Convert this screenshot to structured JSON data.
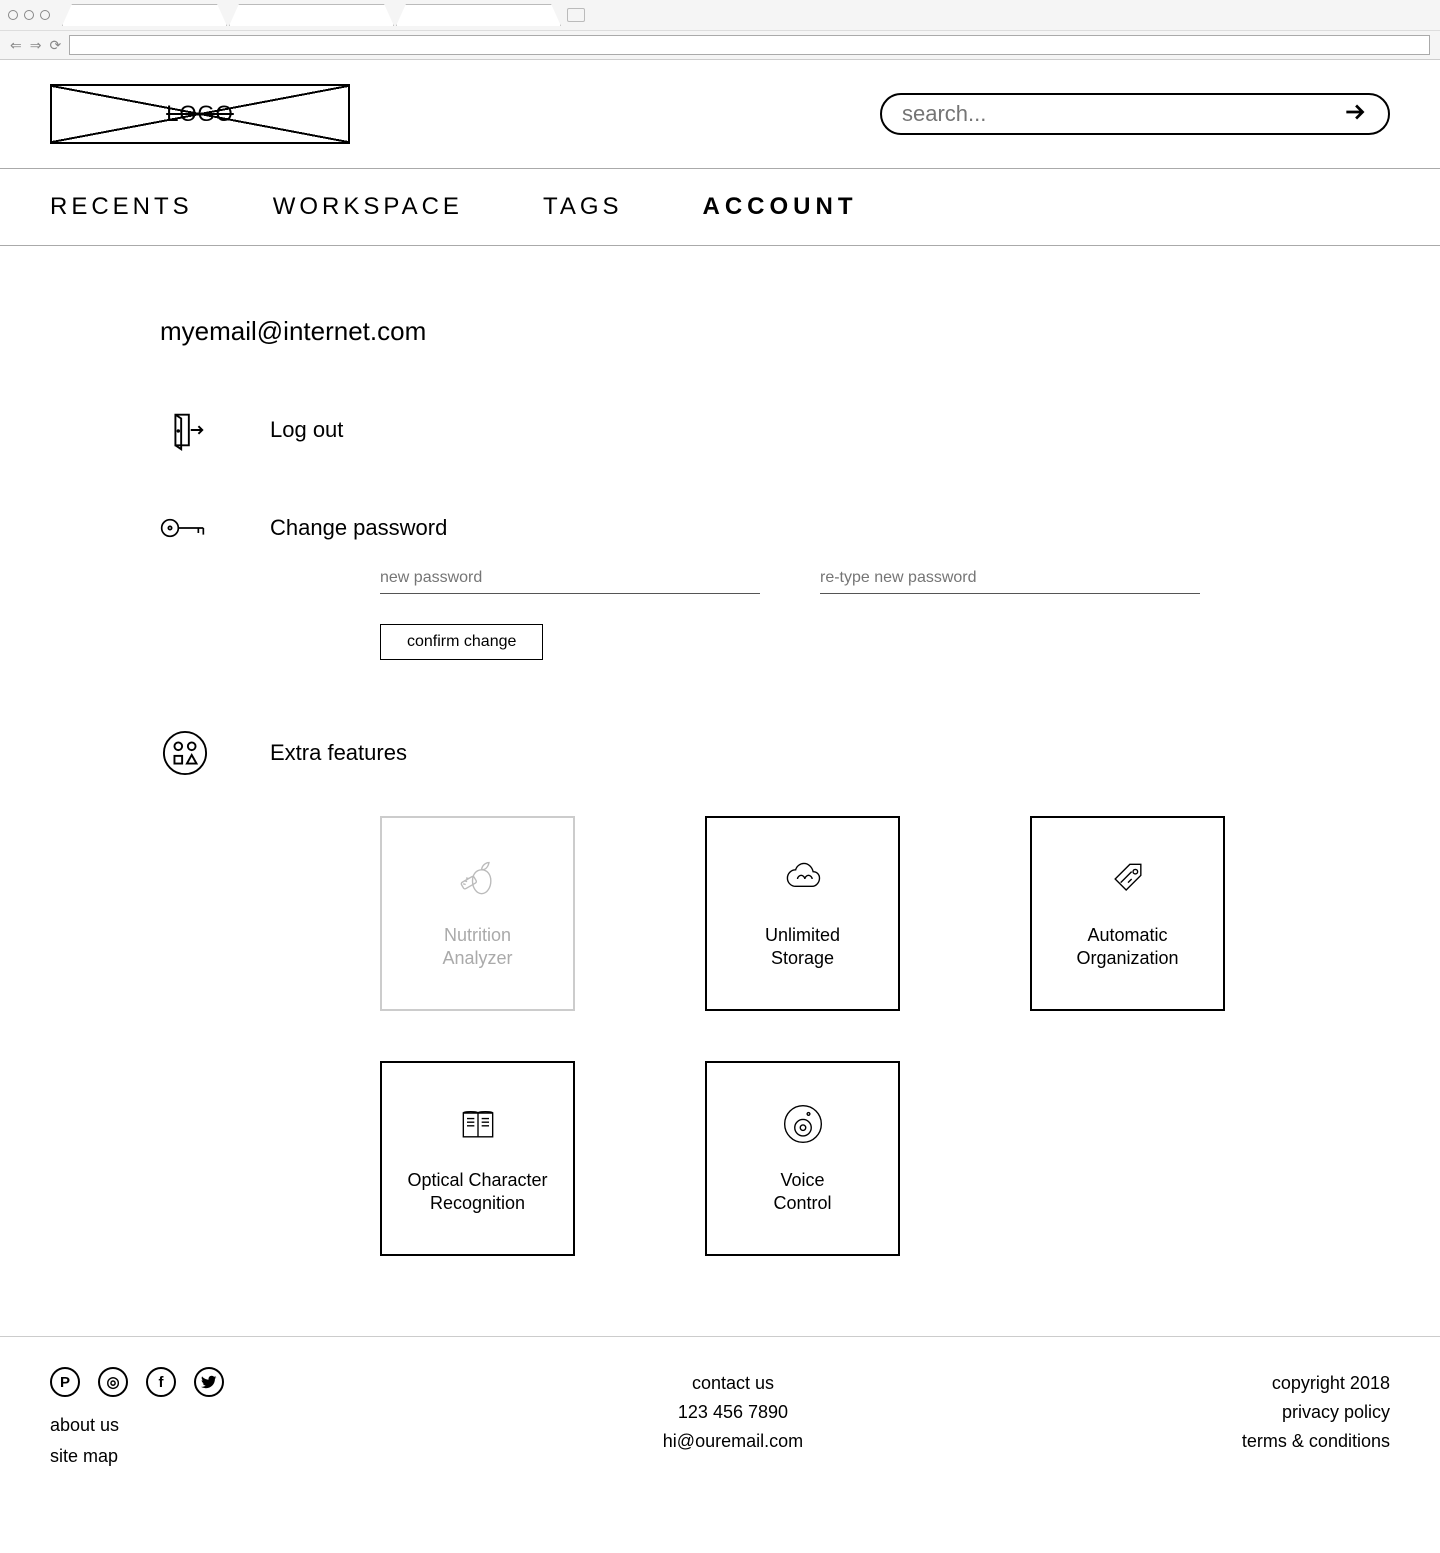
{
  "logo_text": "LOGO",
  "search": {
    "placeholder": "search..."
  },
  "nav": {
    "items": [
      {
        "label": "RECENTS",
        "active": false
      },
      {
        "label": "WORKSPACE",
        "active": false
      },
      {
        "label": "TAGS",
        "active": false
      },
      {
        "label": "ACCOUNT",
        "active": true
      }
    ]
  },
  "account": {
    "email": "myemail@internet.com",
    "logout_label": "Log out",
    "change_password_label": "Change password",
    "new_password_placeholder": "new password",
    "retype_password_placeholder": "re-type new password",
    "confirm_button": "confirm change",
    "extra_features_label": "Extra features",
    "features": [
      {
        "title": "Nutrition Analyzer",
        "icon": "nutrition-icon",
        "disabled": true
      },
      {
        "title": "Unlimited Storage",
        "icon": "cloud-icon",
        "disabled": false
      },
      {
        "title": "Automatic Organization",
        "icon": "tag-icon",
        "disabled": false
      },
      {
        "title": "Optical Character Recognition",
        "icon": "book-icon",
        "disabled": false
      },
      {
        "title": "Voice Control",
        "icon": "speaker-icon",
        "disabled": false
      }
    ]
  },
  "footer": {
    "about": "about us",
    "sitemap": "site map",
    "contact_heading": "contact us",
    "phone": "123 456 7890",
    "email": "hi@ouremail.com",
    "copyright": "copyright 2018",
    "privacy": "privacy policy",
    "terms": "terms & conditions",
    "social": [
      "pinterest",
      "instagram",
      "facebook",
      "twitter"
    ]
  }
}
